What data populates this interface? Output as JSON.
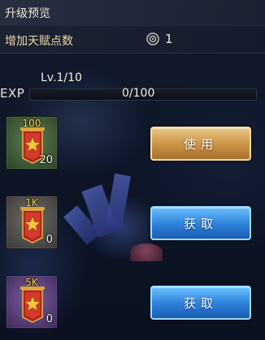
{
  "header": {
    "title": "升级预览"
  },
  "talent": {
    "label": "增加天赋点数",
    "icon": "talent-point-icon",
    "value": "1"
  },
  "progress": {
    "level_text": "Lv.1/10",
    "exp_label": "EXP",
    "exp_text": "0/100",
    "current": 0,
    "max": 100
  },
  "items": [
    {
      "value": "100",
      "count": "20",
      "rarity": "green",
      "icon": "red-banner-star-icon",
      "button_label": "使用",
      "button_style": "gold"
    },
    {
      "value": "1K",
      "count": "0",
      "rarity": "gray",
      "icon": "red-banner-star-icon",
      "button_label": "获取",
      "button_style": "blue"
    },
    {
      "value": "5K",
      "count": "0",
      "rarity": "purple",
      "icon": "red-banner-star-icon",
      "button_label": "获取",
      "button_style": "blue"
    }
  ],
  "colors": {
    "gold_button": "#cf9a4d",
    "blue_button": "#2f84dc",
    "exp_fill": "#2a6fd0",
    "item_value": "#ffd23a"
  }
}
